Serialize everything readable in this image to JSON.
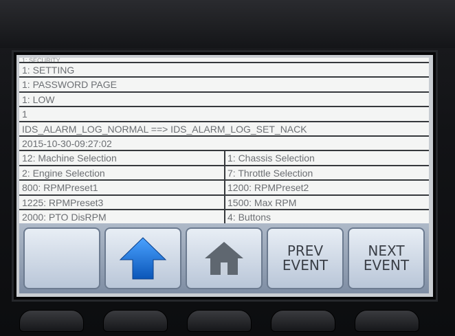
{
  "screen": {
    "top_partial": "1: SECURITY",
    "rows": [
      "1: SETTING",
      "1: PASSWORD PAGE",
      "1: LOW",
      "1",
      "IDS_ALARM_LOG_NORMAL ==> IDS_ALARM_LOG_SET_NACK",
      "2015-10-30-09:27:02"
    ],
    "grid": [
      [
        "12: Machine Selection",
        "1: Chassis Selection"
      ],
      [
        "2: Engine Selection",
        "7: Throttle Selection"
      ],
      [
        "800: RPMPreset1",
        "1200: RPMPreset2"
      ],
      [
        "1225: RPMPreset3",
        "1500: Max RPM"
      ],
      [
        "2000: PTO DisRPM",
        "4: Buttons"
      ]
    ]
  },
  "buttons": {
    "blank": "",
    "up_icon": "up-arrow-icon",
    "home_icon": "home-icon",
    "prev": "PREV\nEVENT",
    "next": "NEXT\nEVENT"
  },
  "colors": {
    "up_arrow": "#1a73d9",
    "home": "#5f6770"
  }
}
